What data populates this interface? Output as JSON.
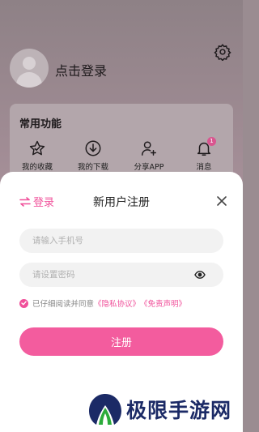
{
  "profile": {
    "login_prompt": "点击登录"
  },
  "common_functions": {
    "title": "常用功能",
    "items": [
      {
        "label": "我的收藏",
        "icon": "star-icon"
      },
      {
        "label": "我的下载",
        "icon": "download-icon"
      },
      {
        "label": "分享APP",
        "icon": "share-user-icon"
      },
      {
        "label": "消息",
        "icon": "bell-icon",
        "badge": "1"
      }
    ]
  },
  "sheet": {
    "switch_label": "登录",
    "title": "新用户注册",
    "phone_placeholder": "请输入手机号",
    "password_placeholder": "请设置密码",
    "agree_text": "已仔细阅读并同意",
    "privacy_link": "《隐私协议》",
    "disclaimer_link": "《免责声明》",
    "register_label": "注册"
  },
  "watermark": {
    "text": "极限手游网"
  },
  "colors": {
    "accent": "#f35c9e",
    "badge": "#d9558f",
    "watermark": "#1b2a66"
  }
}
